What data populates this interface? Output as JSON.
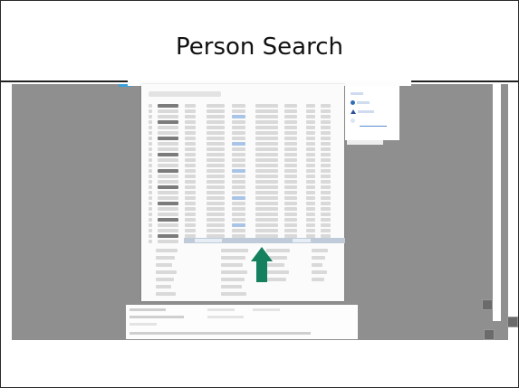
{
  "slide": {
    "title": "Person Search"
  },
  "colors": {
    "arrow": "#14805e",
    "background_band": "#8f8f8f",
    "accent_blue": "#3aa0d8"
  },
  "icons": {
    "arrow": "arrow-up-icon",
    "legend_marker_1": "circle-icon",
    "legend_marker_2": "triangle-icon"
  }
}
